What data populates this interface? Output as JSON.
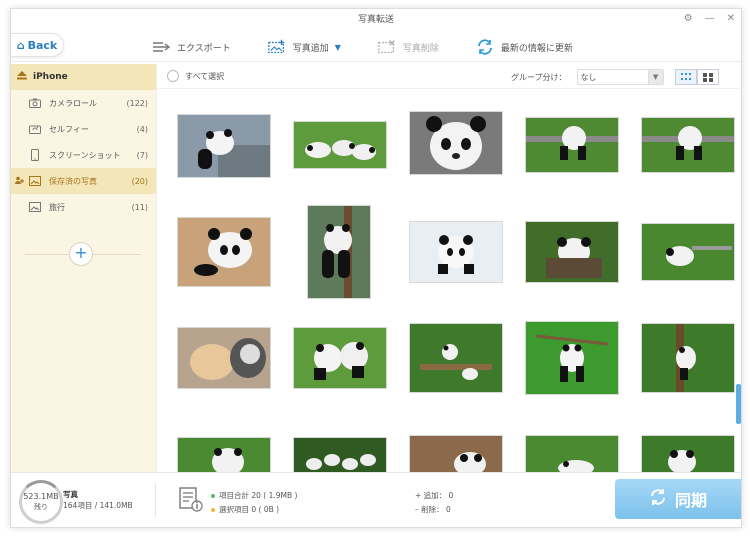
{
  "window": {
    "title": "写真転送"
  },
  "back": {
    "label": "Back"
  },
  "toolbar": {
    "export": "エクスポート",
    "add": "写真追加",
    "delete": "写真削除",
    "refresh": "最新の情報に更新"
  },
  "sidebar": {
    "device": "iPhone",
    "items": [
      {
        "label": "カメラロール",
        "count": "(122)",
        "icon": "camera-icon"
      },
      {
        "label": "セルフィー",
        "count": "(4)",
        "icon": "selfie-camera-icon"
      },
      {
        "label": "スクリーンショット",
        "count": "(7)",
        "icon": "phone-icon"
      },
      {
        "label": "保存済の写真",
        "count": "(20)",
        "icon": "saved-photo-icon"
      },
      {
        "label": "旅行",
        "count": "(11)",
        "icon": "album-icon"
      }
    ],
    "active_index": 3
  },
  "list": {
    "select_all": "すべて選択",
    "group_label": "グループ分け：",
    "group_value": "なし"
  },
  "storage": {
    "free": "523.1MB",
    "free_label": "残り",
    "type": "写真",
    "detail": "164項目 / 141.0MB"
  },
  "totals": {
    "total": "項目合計 20 ( 1.9MB )",
    "selected": "選択項目 0 ( 0B )"
  },
  "changes": {
    "add": "追加： 0",
    "remove": "削除： 0"
  },
  "sync": {
    "label": "同期"
  },
  "colors": {
    "accent": "#3b8ed6",
    "sidebar_bg": "#fbf6e4",
    "sidebar_active": "#f3e6b8",
    "sync": "#8ccbf0"
  }
}
